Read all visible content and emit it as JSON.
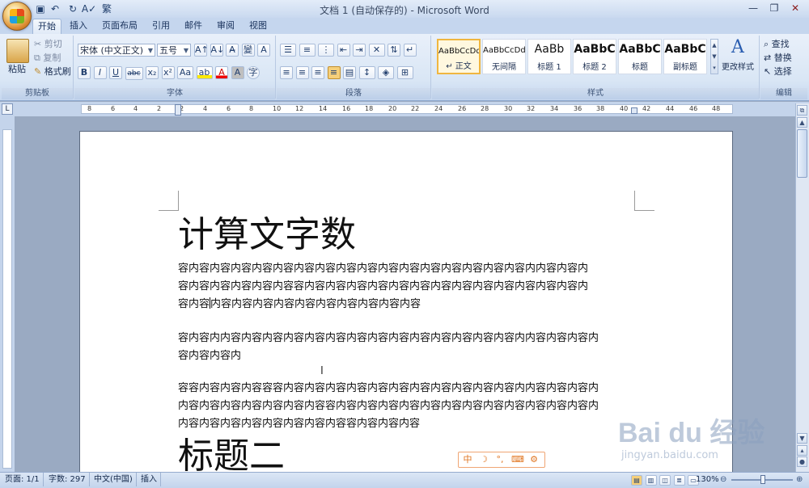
{
  "titlebar": {
    "title": "文档 1 (自动保存的) - Microsoft Word",
    "qa_icons": [
      "save-icon",
      "undo-icon",
      "redo-icon",
      "spelling-icon",
      "traditional-chinese-icon"
    ],
    "qa_labels": [
      "▣",
      "↶",
      "↻",
      "A✓",
      "繁"
    ],
    "win_min": "—",
    "win_max": "❐",
    "win_close": "✕"
  },
  "tabs": [
    "开始",
    "插入",
    "页面布局",
    "引用",
    "邮件",
    "审阅",
    "视图"
  ],
  "ribbon": {
    "clipboard": {
      "paste": "粘贴",
      "cut": "剪切",
      "copy": "复制",
      "format_painter": "格式刷",
      "label": "剪贴板"
    },
    "font": {
      "font_name": "宋体 (中文正文)",
      "font_size": "五号",
      "label": "字体",
      "row2": [
        "B",
        "I",
        "U",
        "abc",
        "x₂",
        "x²",
        "Aa"
      ],
      "row1_btns": [
        "A↑",
        "A↓",
        "A̶",
        "變",
        "A"
      ],
      "highlight": "ab",
      "color": "A",
      "char_shade": "A",
      "enclose": "字"
    },
    "paragraph": {
      "label": "段落"
    },
    "styles": {
      "label": "样式",
      "items": [
        {
          "sample": "AaBbCcDd",
          "name": "↵ 正文",
          "selected": true
        },
        {
          "sample": "AaBbCcDd",
          "name": "无间隔",
          "selected": false
        },
        {
          "sample": "AaBb",
          "name": "标题 1",
          "selected": false
        },
        {
          "sample": "AaBbC",
          "name": "标题 2",
          "selected": false
        },
        {
          "sample": "AaBbC",
          "name": "标题",
          "selected": false
        },
        {
          "sample": "AaBbC",
          "name": "副标题",
          "selected": false
        }
      ],
      "change_styles": "更改样式"
    },
    "editing": {
      "find": "查找",
      "replace": "替换",
      "select": "选择",
      "label": "编辑"
    }
  },
  "ruler_numbers": [
    "8",
    "6",
    "4",
    "2",
    "2",
    "4",
    "6",
    "8",
    "10",
    "12",
    "14",
    "16",
    "18",
    "20",
    "22",
    "24",
    "26",
    "28",
    "30",
    "32",
    "34",
    "36",
    "38",
    "40",
    "42",
    "44",
    "46",
    "48"
  ],
  "document": {
    "heading1": "计算文字数",
    "paragraphs": [
      [
        "容内容内容内容内容内容内容内容内容内容内容内容内容内容内容内容内容内内容内容内",
        "容内容内容内容内容内容容内容内容内容内容内容内容内容内容内容内容内容内容内容内",
        "容内容",
        "内容内容内容内容内容内容内容内容内容内容"
      ],
      [
        "容内容内内容内容内容内容内容内容内容内容内容内容内容内容内容内容内内容内容内容内",
        "容内容内容内"
      ],
      [
        "容容内容内容内容容容内容内容内容内容内容内容内容内容内容内容内容内内容内容内容内",
        "内容内容内容内容内容内容内容容内容内容内容内容内容内容内容内容内容内容内容内容内",
        "内容内容内容内容内容内容内容内容容内容内容内容"
      ]
    ],
    "heading2": "标题二"
  },
  "ime": {
    "items": [
      "中",
      "☽",
      "°,",
      "⌨",
      "⚙"
    ]
  },
  "statusbar": {
    "page": "页面: 1/1",
    "words": "字数: 297",
    "lang": "中文(中国)",
    "mode": "插入",
    "zoom": "130%"
  },
  "watermark": {
    "brand": "Bai du 经验",
    "url": "jingyan.baidu.com"
  }
}
